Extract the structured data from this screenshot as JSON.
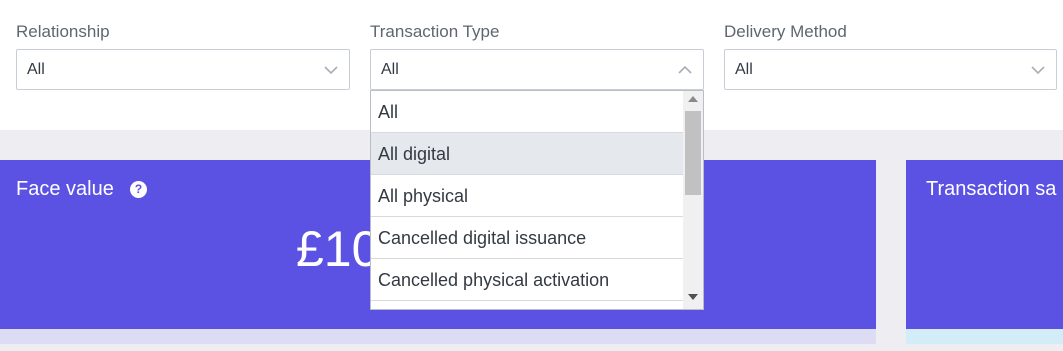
{
  "filters": {
    "relationship": {
      "label": "Relationship",
      "value": "All"
    },
    "transaction_type": {
      "label": "Transaction Type",
      "value": "All"
    },
    "delivery_method": {
      "label": "Delivery Method",
      "value": "All"
    }
  },
  "dropdown": {
    "options": [
      "All",
      "All digital",
      "All physical",
      "Cancelled digital issuance",
      "Cancelled physical activation"
    ],
    "highlighted": "All digital"
  },
  "cards": {
    "face_value": {
      "title": "Face value",
      "value": "£10"
    },
    "transaction_sales": {
      "title": "Transaction sa"
    }
  },
  "colors": {
    "card_bg": "#5b52e3",
    "face_value_strip": "#dcdcf5",
    "transaction_strip": "#d2ecf8"
  },
  "icons": {
    "help": "question-circle-icon",
    "chevron_down": "chevron-down-icon",
    "chevron_up": "chevron-up-icon"
  }
}
